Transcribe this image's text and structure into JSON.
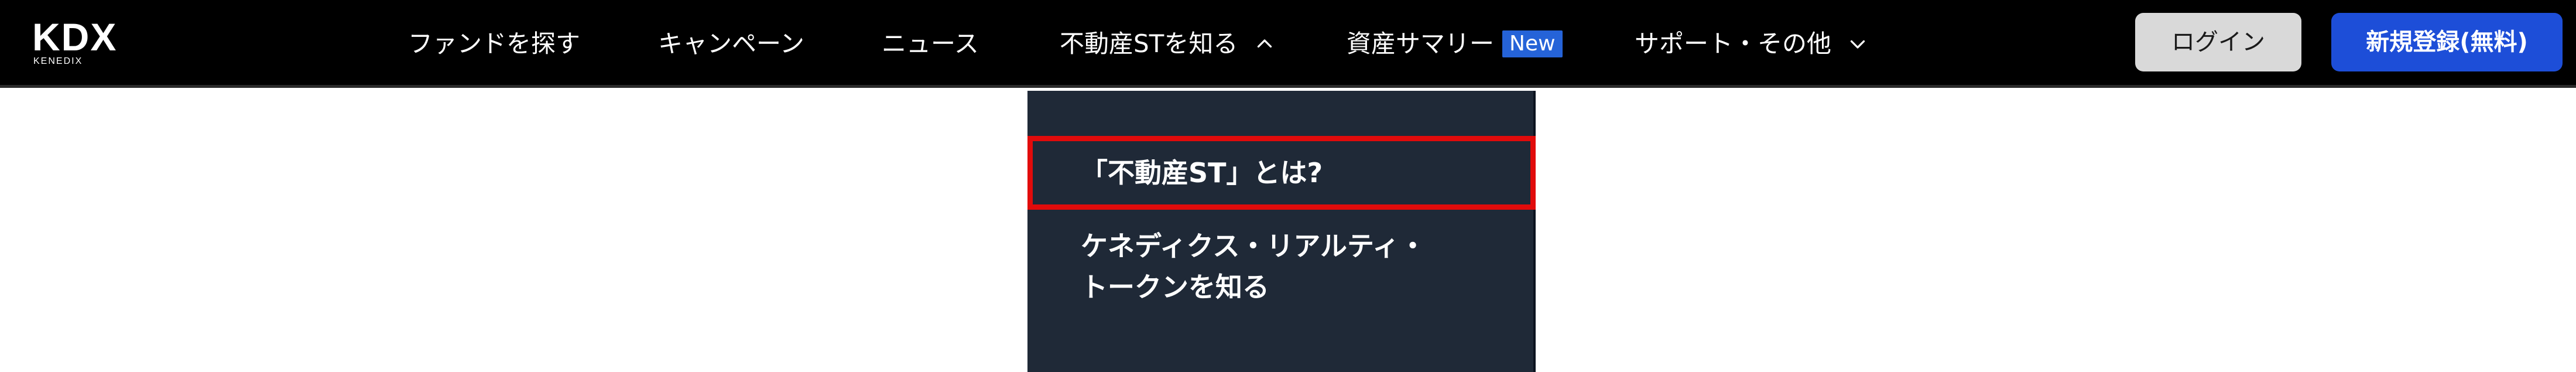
{
  "brand": {
    "logo_text": "KDX",
    "logo_subtext": "KENEDIX"
  },
  "nav": {
    "items": [
      {
        "label": "ファンドを探す"
      },
      {
        "label": "キャンペーン"
      },
      {
        "label": "ニュース"
      },
      {
        "label": "不動産STを知る",
        "chevron": "chevron-up-icon"
      },
      {
        "label": "資産サマリー",
        "badge": "New"
      },
      {
        "label": "サポート・その他",
        "chevron": "chevron-down-icon"
      }
    ]
  },
  "auth": {
    "login_label": "ログイン",
    "register_label": "新規登録(無料)"
  },
  "dropdown": {
    "items": [
      {
        "label": "「不動産ST」とは?"
      },
      {
        "label_line1": "ケネディクス・リアルティ・",
        "label_line2": "トークンを知る"
      }
    ]
  },
  "colors": {
    "header_bg": "#000000",
    "dropdown_bg": "#1f2937",
    "highlight_border": "#e10b0b",
    "register_bg": "#1d4ed8",
    "login_bg": "#d9d9d9",
    "badge_bg": "#2563d8"
  }
}
